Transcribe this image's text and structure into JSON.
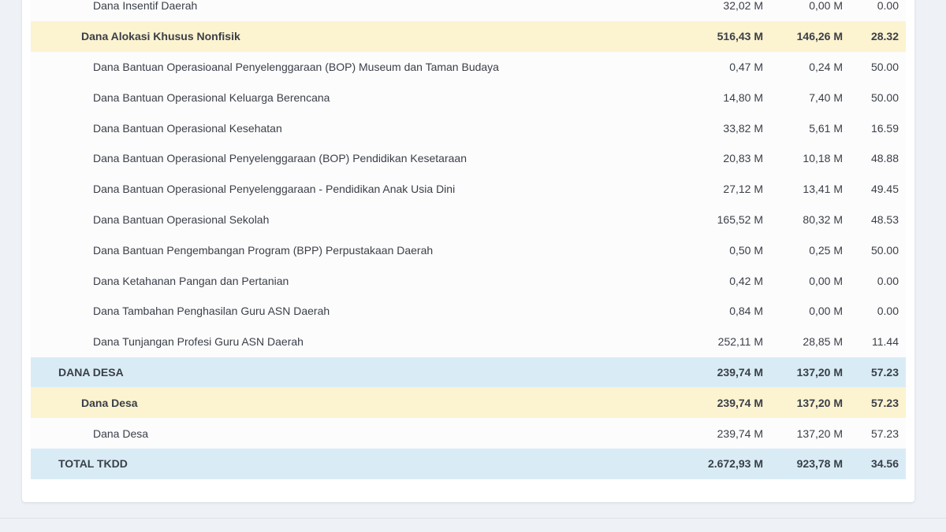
{
  "rows": [
    {
      "level": 3,
      "name": "Dana Insentif Daerah",
      "pagu": "32,02 M",
      "realisasi": "0,00 M",
      "persen": "0.00"
    },
    {
      "level": 2,
      "name": "Dana Alokasi Khusus Nonfisik",
      "pagu": "516,43 M",
      "realisasi": "146,26 M",
      "persen": "28.32"
    },
    {
      "level": 3,
      "name": "Dana Bantuan Operasioanal Penyelenggaraan (BOP) Museum dan Taman Budaya",
      "pagu": "0,47 M",
      "realisasi": "0,24 M",
      "persen": "50.00"
    },
    {
      "level": 3,
      "name": "Dana Bantuan Operasional Keluarga Berencana",
      "pagu": "14,80 M",
      "realisasi": "7,40 M",
      "persen": "50.00"
    },
    {
      "level": 3,
      "name": "Dana Bantuan Operasional Kesehatan",
      "pagu": "33,82 M",
      "realisasi": "5,61 M",
      "persen": "16.59"
    },
    {
      "level": 3,
      "name": "Dana Bantuan Operasional Penyelenggaraan (BOP) Pendidikan Kesetaraan",
      "pagu": "20,83 M",
      "realisasi": "10,18 M",
      "persen": "48.88"
    },
    {
      "level": 3,
      "name": "Dana Bantuan Operasional Penyelenggaraan - Pendidikan Anak Usia Dini",
      "pagu": "27,12 M",
      "realisasi": "13,41 M",
      "persen": "49.45"
    },
    {
      "level": 3,
      "name": "Dana Bantuan Operasional Sekolah",
      "pagu": "165,52 M",
      "realisasi": "80,32 M",
      "persen": "48.53"
    },
    {
      "level": 3,
      "name": "Dana Bantuan Pengembangan Program (BPP) Perpustakaan Daerah",
      "pagu": "0,50 M",
      "realisasi": "0,25 M",
      "persen": "50.00"
    },
    {
      "level": 3,
      "name": "Dana Ketahanan Pangan dan Pertanian",
      "pagu": "0,42 M",
      "realisasi": "0,00 M",
      "persen": "0.00"
    },
    {
      "level": 3,
      "name": "Dana Tambahan Penghasilan Guru ASN Daerah",
      "pagu": "0,84 M",
      "realisasi": "0,00 M",
      "persen": "0.00"
    },
    {
      "level": 3,
      "name": "Dana Tunjangan Profesi Guru ASN Daerah",
      "pagu": "252,11 M",
      "realisasi": "28,85 M",
      "persen": "11.44"
    },
    {
      "level": 1,
      "name": "DANA DESA",
      "pagu": "239,74 M",
      "realisasi": "137,20 M",
      "persen": "57.23"
    },
    {
      "level": 2,
      "name": "Dana Desa",
      "pagu": "239,74 M",
      "realisasi": "137,20 M",
      "persen": "57.23"
    },
    {
      "level": 3,
      "name": "Dana Desa",
      "pagu": "239,74 M",
      "realisasi": "137,20 M",
      "persen": "57.23"
    },
    {
      "level": 1,
      "name": "TOTAL TKDD",
      "pagu": "2.672,93 M",
      "realisasi": "923,78 M",
      "persen": "34.56"
    }
  ]
}
